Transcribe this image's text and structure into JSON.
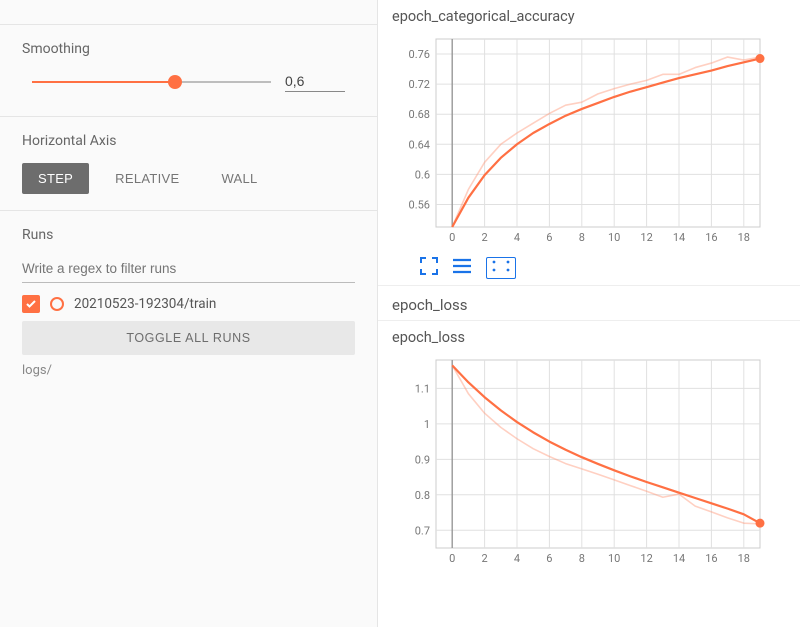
{
  "sidebar": {
    "smoothing": {
      "label": "Smoothing",
      "value": "0,6",
      "fraction": 0.6
    },
    "haxis": {
      "label": "Horizontal Axis",
      "options": [
        "STEP",
        "RELATIVE",
        "WALL"
      ],
      "active": "STEP"
    },
    "runs": {
      "label": "Runs",
      "filter_placeholder": "Write a regex to filter runs",
      "items": [
        {
          "name": "20210523-192304/train",
          "checked": true,
          "color": "#ff7043"
        }
      ],
      "toggle_label": "TOGGLE ALL RUNS",
      "logdir": "logs/"
    }
  },
  "charts": {
    "accuracy": {
      "title": "epoch_categorical_accuracy",
      "xticks": [
        0,
        2,
        4,
        6,
        8,
        10,
        12,
        14,
        16,
        18
      ],
      "yticks": [
        0.56,
        0.6,
        0.64,
        0.68,
        0.72,
        0.76
      ],
      "series": {
        "color": "#ff7043"
      }
    },
    "loss_section": {
      "title": "epoch_loss"
    },
    "loss": {
      "title": "epoch_loss",
      "xticks": [
        0,
        2,
        4,
        6,
        8,
        10,
        12,
        14,
        16,
        18
      ],
      "yticks": [
        0.7,
        0.8,
        0.9,
        1,
        1.1
      ],
      "series": {
        "color": "#ff7043"
      }
    }
  },
  "chart_data": [
    {
      "type": "line",
      "title": "epoch_categorical_accuracy",
      "xlabel": "",
      "ylabel": "",
      "xlim": [
        -1,
        19
      ],
      "ylim": [
        0.53,
        0.78
      ],
      "series": [
        {
          "name": "20210523-192304/train (smoothed)",
          "x": [
            0,
            1,
            2,
            3,
            4,
            5,
            6,
            7,
            8,
            9,
            10,
            11,
            12,
            13,
            14,
            15,
            16,
            17,
            18,
            19
          ],
          "values": [
            0.53,
            0.569,
            0.599,
            0.622,
            0.64,
            0.655,
            0.667,
            0.678,
            0.687,
            0.695,
            0.703,
            0.71,
            0.716,
            0.722,
            0.728,
            0.733,
            0.738,
            0.744,
            0.749,
            0.754
          ]
        },
        {
          "name": "20210523-192304/train (raw)",
          "x": [
            0,
            1,
            2,
            3,
            4,
            5,
            6,
            7,
            8,
            9,
            10,
            11,
            12,
            13,
            14,
            15,
            16,
            17,
            18,
            19
          ],
          "values": [
            0.53,
            0.58,
            0.616,
            0.64,
            0.655,
            0.668,
            0.681,
            0.692,
            0.696,
            0.707,
            0.714,
            0.72,
            0.725,
            0.733,
            0.733,
            0.742,
            0.748,
            0.756,
            0.752,
            0.756
          ]
        }
      ]
    },
    {
      "type": "line",
      "title": "epoch_loss",
      "xlabel": "",
      "ylabel": "",
      "xlim": [
        -1,
        19
      ],
      "ylim": [
        0.65,
        1.18
      ],
      "series": [
        {
          "name": "20210523-192304/train (smoothed)",
          "x": [
            0,
            1,
            2,
            3,
            4,
            5,
            6,
            7,
            8,
            9,
            10,
            11,
            12,
            13,
            14,
            15,
            16,
            17,
            18,
            19
          ],
          "values": [
            1.165,
            1.117,
            1.075,
            1.038,
            1.005,
            0.976,
            0.95,
            0.927,
            0.906,
            0.887,
            0.869,
            0.852,
            0.836,
            0.821,
            0.806,
            0.791,
            0.776,
            0.761,
            0.745,
            0.72
          ]
        },
        {
          "name": "20210523-192304/train (raw)",
          "x": [
            0,
            1,
            2,
            3,
            4,
            5,
            6,
            7,
            8,
            9,
            10,
            11,
            12,
            13,
            14,
            15,
            16,
            17,
            18,
            19
          ],
          "values": [
            1.165,
            1.085,
            1.03,
            0.99,
            0.958,
            0.93,
            0.908,
            0.888,
            0.873,
            0.858,
            0.842,
            0.826,
            0.81,
            0.793,
            0.802,
            0.768,
            0.752,
            0.735,
            0.72,
            0.718
          ]
        }
      ]
    }
  ]
}
